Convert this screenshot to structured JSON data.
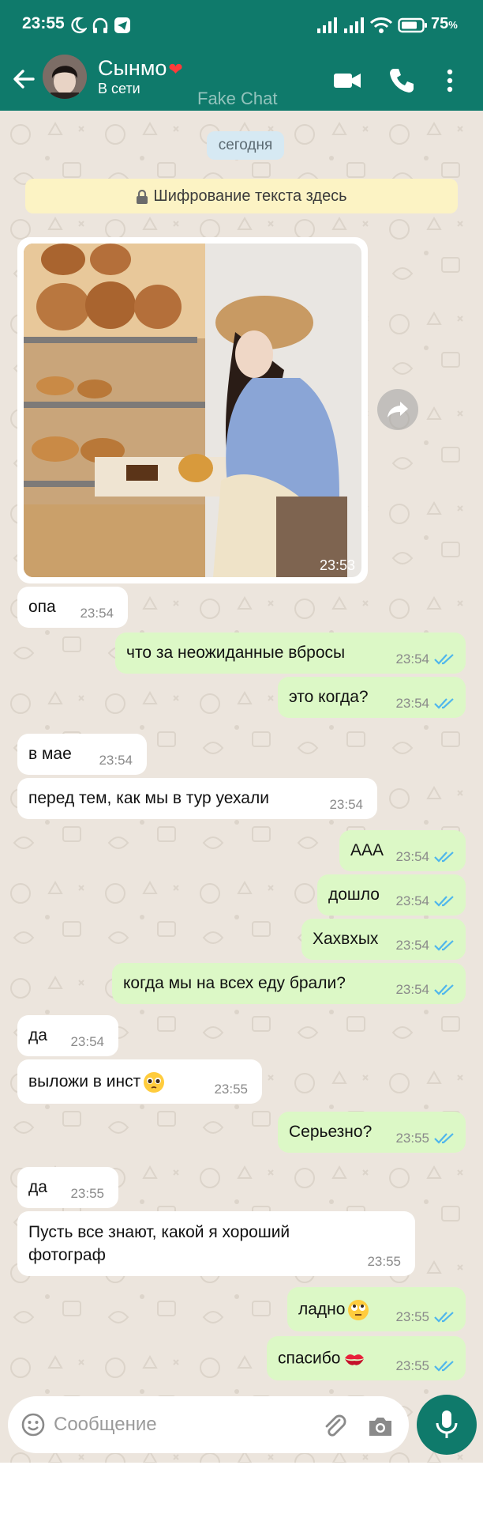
{
  "status_bar": {
    "time": "23:55",
    "battery": "75"
  },
  "header": {
    "contact_name": "Сынмо",
    "contact_status": "В сети",
    "watermark": "Fake Chat"
  },
  "chat": {
    "date_chip": "сегодня",
    "encryption_notice": "Шифрование текста здесь",
    "photo_time": "23:53",
    "messages": [
      {
        "dir": "in",
        "text": "опа",
        "time": "23:54"
      },
      {
        "dir": "out",
        "text": "что за неожиданные вбросы",
        "time": "23:54"
      },
      {
        "dir": "out",
        "text": "это когда?",
        "time": "23:54"
      },
      {
        "dir": "in",
        "text": "в мае",
        "time": "23:54"
      },
      {
        "dir": "in",
        "text": "перед тем, как мы в тур уехали",
        "time": "23:54"
      },
      {
        "dir": "out",
        "text": "ААА",
        "time": "23:54"
      },
      {
        "dir": "out",
        "text": "дошло",
        "time": "23:54"
      },
      {
        "dir": "out",
        "text": "Хахвхых",
        "time": "23:54"
      },
      {
        "dir": "out",
        "text": "когда мы на всех еду брали?",
        "time": "23:54"
      },
      {
        "dir": "in",
        "text": "да",
        "time": "23:54"
      },
      {
        "dir": "in",
        "text": "выложи в инст",
        "time": "23:55",
        "emoji": "pleading-face"
      },
      {
        "dir": "out",
        "text": "Серьезно?",
        "time": "23:55"
      },
      {
        "dir": "in",
        "text": "да",
        "time": "23:55"
      },
      {
        "dir": "in",
        "text": "Пусть все знают, какой я хороший",
        "text2": "фотограф",
        "time": "23:55"
      },
      {
        "dir": "out",
        "text": "ладно",
        "time": "23:55",
        "emoji": "rolling-eyes-face"
      },
      {
        "dir": "out",
        "text": "спасибо",
        "time": "23:55",
        "emoji": "kiss-mark"
      }
    ]
  },
  "composer": {
    "placeholder": "Сообщение"
  },
  "colors": {
    "header": "#0f7a6b",
    "chat_bg": "#ece5dd",
    "outgoing": "#dcf8c6",
    "incoming": "#ffffff",
    "read_ticks": "#4fb6ec"
  }
}
